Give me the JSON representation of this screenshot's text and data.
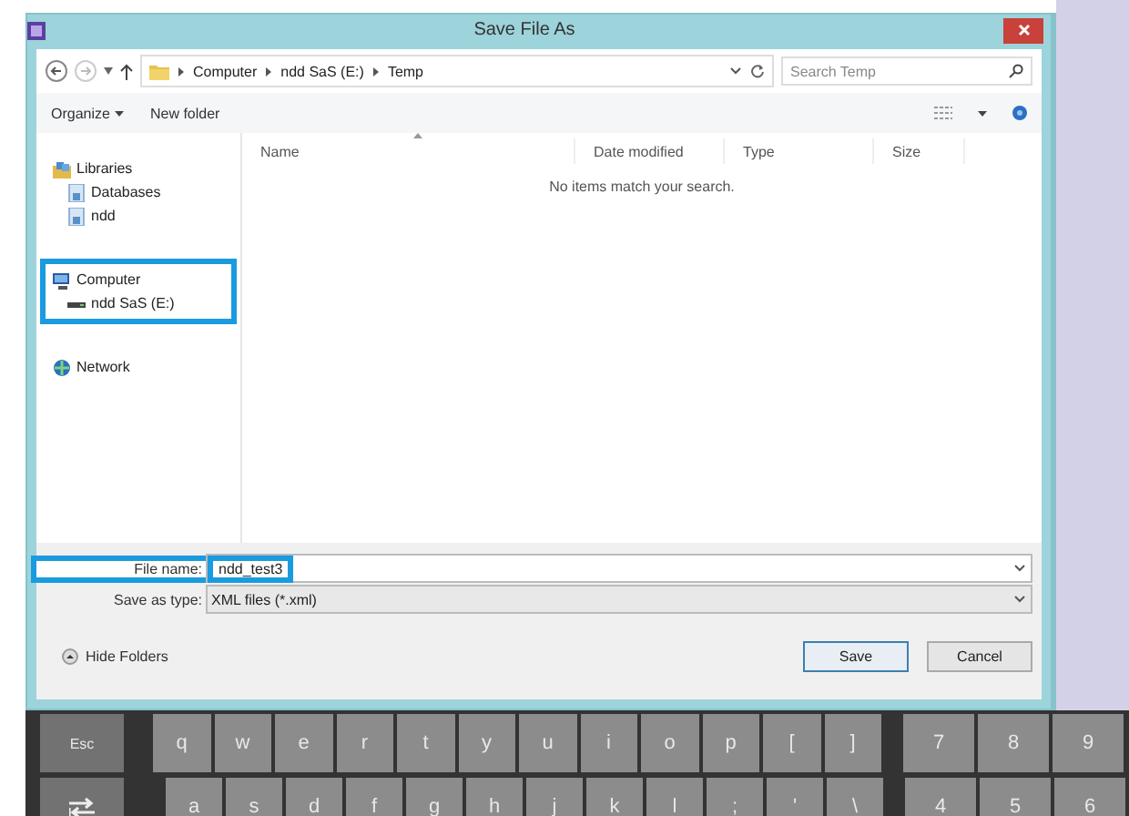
{
  "window": {
    "title": "Save File As"
  },
  "address_bar": {
    "path": [
      "Computer",
      "ndd SaS (E:)",
      "Temp"
    ]
  },
  "search": {
    "placeholder": "Search Temp"
  },
  "toolbar": {
    "organize": "Organize",
    "new_folder": "New folder"
  },
  "nav": [
    {
      "label": "Libraries",
      "kind": "library",
      "highlighted": false,
      "children": [
        {
          "label": "Databases",
          "kind": "library-item"
        },
        {
          "label": "ndd",
          "kind": "library-item"
        }
      ]
    },
    {
      "label": "Computer",
      "kind": "computer",
      "highlighted": true,
      "children": [
        {
          "label": "ndd SaS (E:)",
          "kind": "drive"
        }
      ]
    },
    {
      "label": "Network",
      "kind": "network",
      "highlighted": false
    }
  ],
  "columns": [
    {
      "label": "Name",
      "sorted": true
    },
    {
      "label": "Date modified",
      "sorted": false
    },
    {
      "label": "Type",
      "sorted": false
    },
    {
      "label": "Size",
      "sorted": false
    }
  ],
  "empty_message": "No items match your search.",
  "file_name": {
    "label": "File name:",
    "value": "ndd_test3",
    "highlighted": true
  },
  "save_as_type": {
    "label": "Save as type:",
    "value": "XML files (*.xml)"
  },
  "hide_folders": "Hide Folders",
  "buttons": [
    {
      "label": "Save",
      "default": true
    },
    {
      "label": "Cancel",
      "default": false
    }
  ],
  "keyboard": {
    "rows": [
      [
        {
          "kind": "function",
          "label": "Esc"
        },
        {
          "kind": "letter",
          "label": "q"
        },
        {
          "kind": "letter",
          "label": "w"
        },
        {
          "kind": "letter",
          "label": "e"
        },
        {
          "kind": "letter",
          "label": "r"
        },
        {
          "kind": "letter",
          "label": "t"
        },
        {
          "kind": "letter",
          "label": "y"
        },
        {
          "kind": "letter",
          "label": "u"
        },
        {
          "kind": "letter",
          "label": "i"
        },
        {
          "kind": "letter",
          "label": "o"
        },
        {
          "kind": "letter",
          "label": "p"
        },
        {
          "kind": "letter",
          "label": "["
        },
        {
          "kind": "letter",
          "label": "]"
        },
        {
          "kind": "number",
          "label": "7"
        },
        {
          "kind": "number",
          "label": "8"
        },
        {
          "kind": "number",
          "label": "9"
        }
      ],
      [
        {
          "kind": "tab"
        },
        {
          "kind": "letter",
          "label": "a"
        },
        {
          "kind": "letter",
          "label": "s"
        },
        {
          "kind": "letter",
          "label": "d"
        },
        {
          "kind": "letter",
          "label": "f"
        },
        {
          "kind": "letter",
          "label": "g"
        },
        {
          "kind": "letter",
          "label": "h"
        },
        {
          "kind": "letter",
          "label": "j"
        },
        {
          "kind": "letter",
          "label": "k"
        },
        {
          "kind": "letter",
          "label": "l"
        },
        {
          "kind": "letter",
          "label": ";"
        },
        {
          "kind": "letter",
          "label": "'"
        },
        {
          "kind": "letter",
          "label": "\\"
        },
        {
          "kind": "number",
          "label": "4"
        },
        {
          "kind": "number",
          "label": "5"
        },
        {
          "kind": "number",
          "label": "6"
        }
      ]
    ]
  }
}
